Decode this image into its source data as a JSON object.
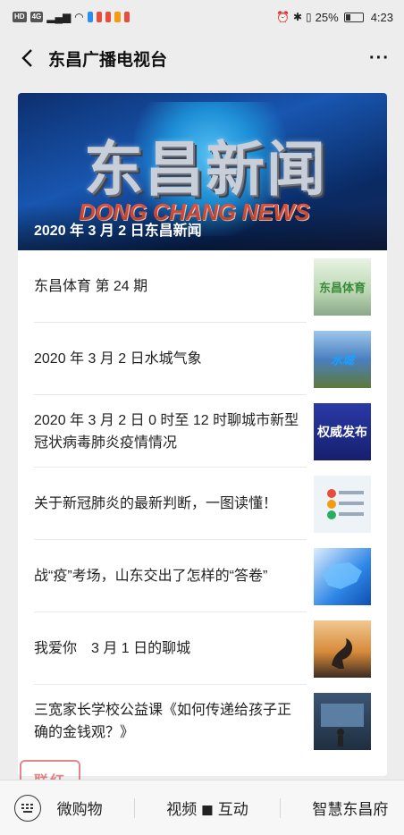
{
  "status_bar": {
    "left_badges": [
      "HD",
      "4G"
    ],
    "battery": "25%",
    "time": "4:23"
  },
  "header": {
    "title": "东昌广播电视台",
    "more": "···"
  },
  "banner": {
    "title": "东昌新闻",
    "subtitle": "DONG CHANG NEWS",
    "caption": "2020 年 3 月 2 日东昌新闻"
  },
  "articles": [
    {
      "title": "东昌体育 第 24 期",
      "thumb_text": "东昌体育",
      "thumb_color": "#3a8a3a"
    },
    {
      "title": "2020 年 3 月 2 日水城气象",
      "thumb_text": "水城",
      "thumb_color": "#3a7fd0"
    },
    {
      "title": "2020 年 3 月 2 日 0 时至 12 时聊城市新型冠状病毒肺炎疫情情况",
      "thumb_text": "权威发布",
      "thumb_color": "#2a3a9a"
    },
    {
      "title": "关于新冠肺炎的最新判断，一图读懂！",
      "thumb_text": "",
      "thumb_color": "#e6eef6"
    },
    {
      "title": "战“疫”考场，山东交出了怎样的“答卷”",
      "thumb_text": "",
      "thumb_color": "#1d6fd6"
    },
    {
      "title": "我爱你　3 月 1 日的聊城",
      "thumb_text": "",
      "thumb_color": "#d2883a"
    },
    {
      "title": "三宽家长学校公益课《如何传递给孩子正确的金钱观？》",
      "thumb_text": "",
      "thumb_color": "#2a3f5a"
    }
  ],
  "bottom_menu": {
    "items": [
      "微购物",
      "视频 ◼ 互动",
      "智慧东昌府"
    ]
  },
  "seal": {
    "text": "联红"
  }
}
